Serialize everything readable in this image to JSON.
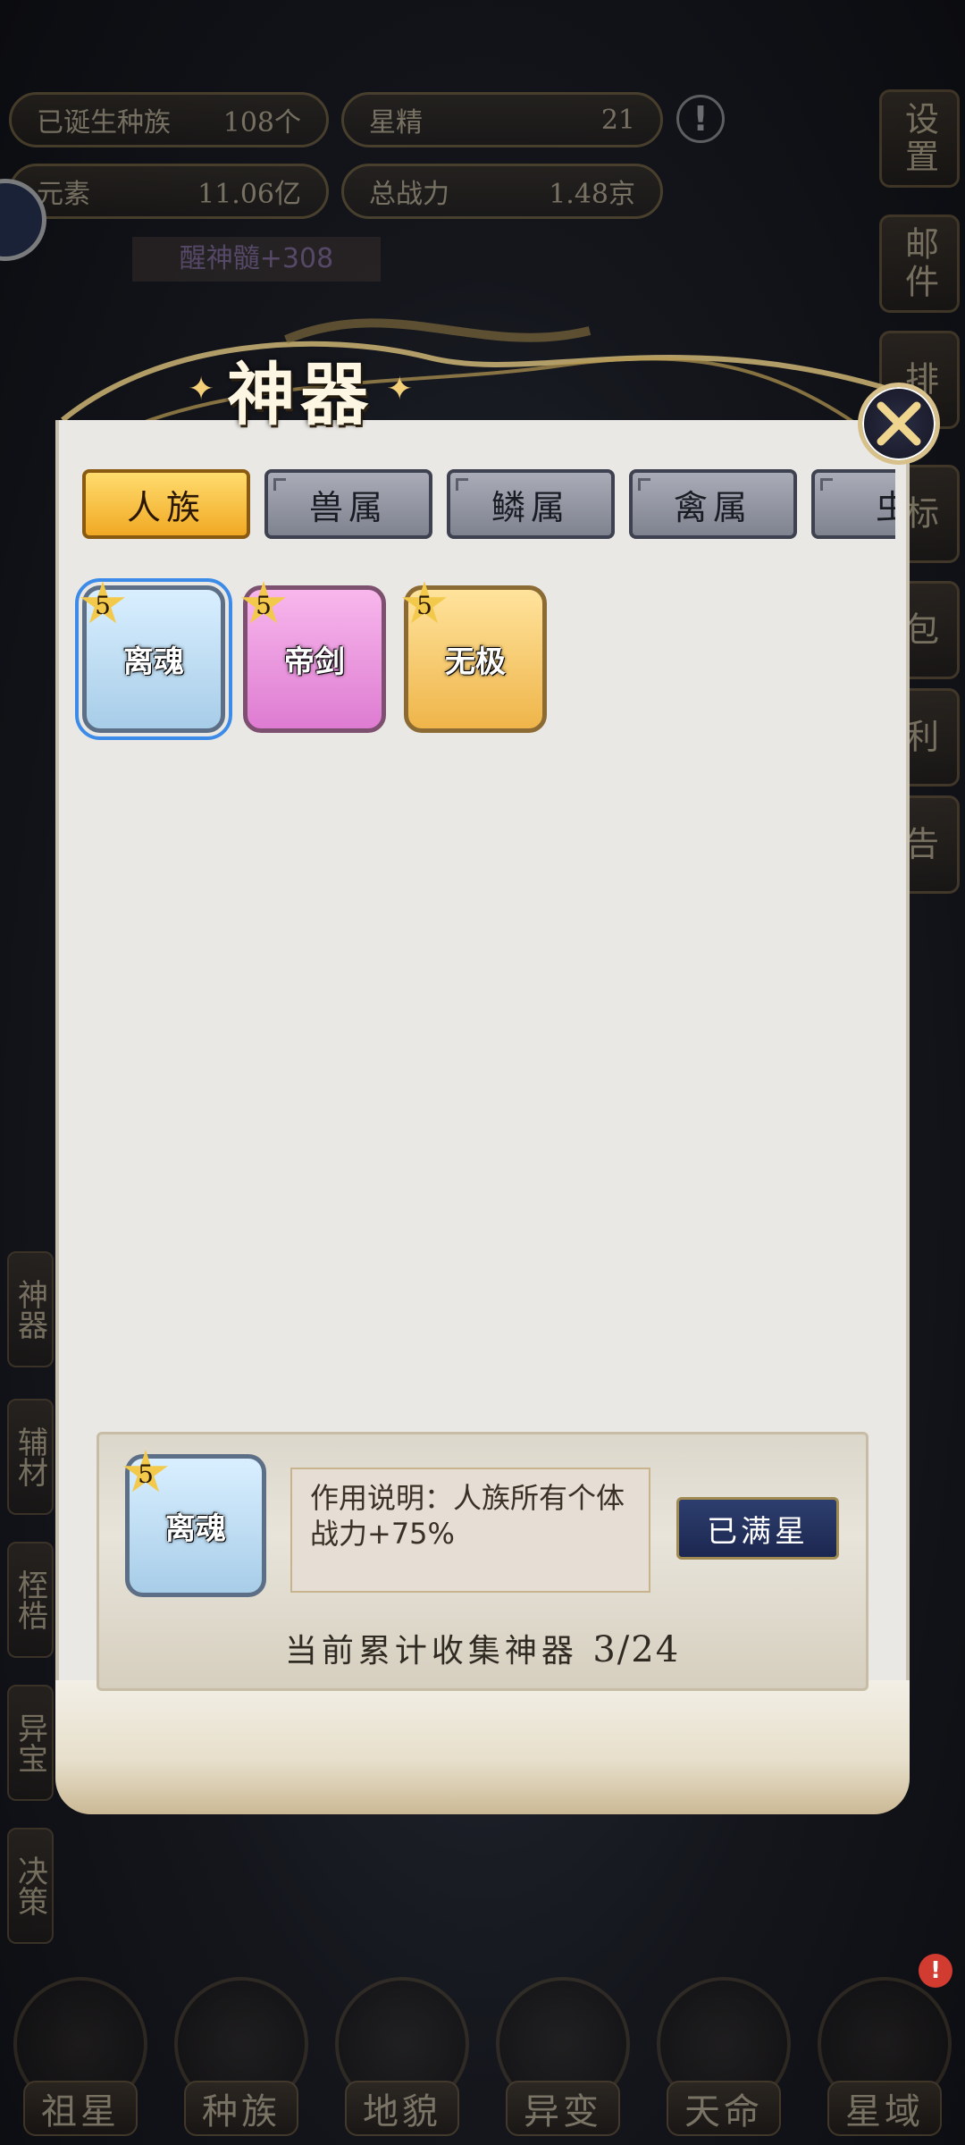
{
  "hud": {
    "born_races_label": "已诞生种族",
    "born_races_value": "108个",
    "star_essence_label": "星精",
    "star_essence_value": "21",
    "elements_label": "元素",
    "elements_value": "11.06亿",
    "total_power_label": "总战力",
    "total_power_value": "1.48京",
    "buff_text": "醒神髓+308",
    "right_menu": [
      "设置",
      "邮件",
      "排",
      "标",
      "包",
      "利",
      "告"
    ],
    "left_menu": [
      "神器",
      "辅材",
      "桎梏",
      "异宝",
      "决策"
    ],
    "bottom_nav": [
      "祖星",
      "种族",
      "地貌",
      "异变",
      "天命",
      "星域"
    ]
  },
  "modal": {
    "title": "神器",
    "tabs": [
      "人族",
      "兽属",
      "鳞属",
      "禽属",
      "虫"
    ],
    "active_tab": "人族",
    "artifacts": [
      {
        "name": "离魂",
        "stars": "5",
        "color": "blue",
        "selected": true
      },
      {
        "name": "帝剑",
        "stars": "5",
        "color": "pink",
        "selected": false
      },
      {
        "name": "无极",
        "stars": "5",
        "color": "gold",
        "selected": false
      }
    ],
    "detail": {
      "name": "离魂",
      "stars": "5",
      "description": "作用说明：人族所有个体战力+75%",
      "button_label": "已满星"
    },
    "collection_label": "当前累计收集神器",
    "collection_count": "3/24"
  },
  "colors": {
    "accent_gold": "#f1a924",
    "panel_bg": "#eae8e4",
    "button_navy": "#1c2750",
    "selection_blue": "#3d8be8"
  }
}
